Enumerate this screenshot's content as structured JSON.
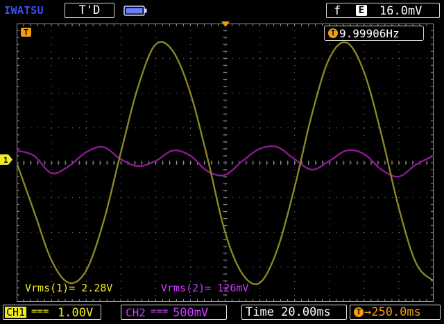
{
  "header": {
    "brand": "IWATSU",
    "run_status": "T'D",
    "battery_icon": "battery-icon",
    "trigger": {
      "edge_symbol": "f",
      "source": "E",
      "level": "16.0mV"
    }
  },
  "markers": {
    "trigger_position_label": "T",
    "ch1_label": "1"
  },
  "frequency_readout": {
    "badge": "T",
    "value": "9.99906Hz"
  },
  "measurements": {
    "ch1": "Vrms(1)= 2.28V",
    "ch2": "Vrms(2)= 126mV"
  },
  "footer": {
    "ch1": {
      "label": "CH1",
      "coupling": "===",
      "scale": "1.00V"
    },
    "ch2": {
      "label": "CH2",
      "coupling": "===",
      "scale": "500mV"
    },
    "timebase": "Time 20.00ms",
    "delay": {
      "badge": "T",
      "value": "→250.0ms"
    }
  },
  "colors": {
    "background": "#000000",
    "grid": "#9a9a9a",
    "ch1": "#f0ec1f",
    "ch1_trace": "#8a8724",
    "ch2": "#cf3dff",
    "ch2_trace": "#8b1a96",
    "accent": "#f39b13",
    "brand": "#3a4dff"
  },
  "chart_data": {
    "type": "line",
    "xlabel": "",
    "ylabel": "",
    "grid": true,
    "x_divisions": 12,
    "y_divisions": 8,
    "x_range_div": [
      0,
      12
    ],
    "y_range_div": [
      -4,
      4
    ],
    "series": [
      {
        "name": "CH1",
        "color": "#8a8724",
        "x_div": [
          0,
          0.5,
          1,
          1.5,
          2,
          2.5,
          3,
          3.5,
          4,
          4.5,
          5,
          5.5,
          6,
          6.5,
          7,
          7.5,
          8,
          8.5,
          9,
          9.5,
          10,
          10.5,
          11,
          11.5,
          12
        ],
        "y_div": [
          0,
          -1.4,
          -2.8,
          -3.45,
          -3.1,
          -1.7,
          0.3,
          2.2,
          3.4,
          3.2,
          2.0,
          0.1,
          -2.0,
          -3.2,
          -3.45,
          -2.5,
          -0.7,
          1.4,
          3.0,
          3.45,
          2.6,
          0.8,
          -1.3,
          -2.9,
          -3.4
        ]
      },
      {
        "name": "CH2",
        "color": "#8b1a96",
        "x_div": [
          0,
          0.5,
          1,
          1.5,
          2,
          2.5,
          3,
          3.5,
          4,
          4.5,
          5,
          5.5,
          6,
          6.5,
          7,
          7.5,
          8,
          8.5,
          9,
          9.5,
          10,
          10.5,
          11,
          11.5,
          12
        ],
        "y_div": [
          0.35,
          0.2,
          -0.3,
          -0.1,
          0.3,
          0.45,
          0.1,
          -0.1,
          0.05,
          0.35,
          0.2,
          -0.25,
          -0.35,
          0.05,
          0.4,
          0.45,
          0.1,
          -0.2,
          0.05,
          0.35,
          0.25,
          -0.2,
          -0.4,
          -0.05,
          0.2
        ]
      }
    ]
  }
}
